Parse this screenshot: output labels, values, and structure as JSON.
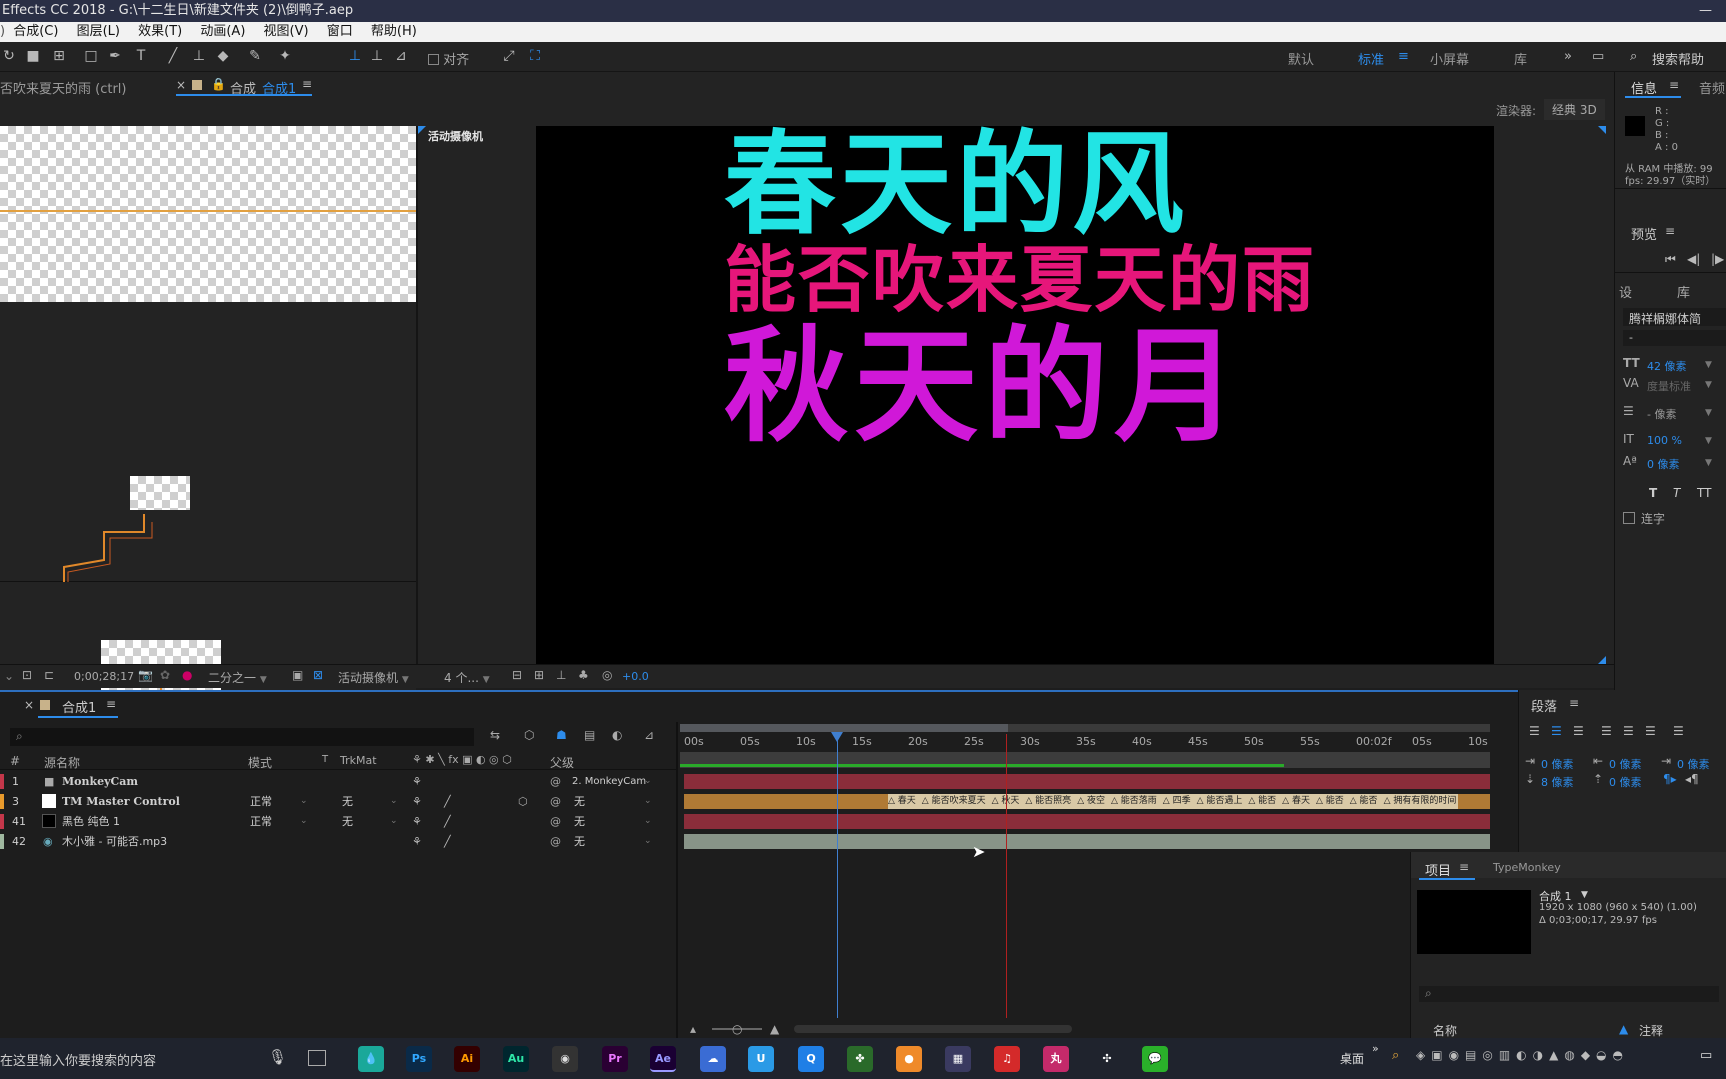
{
  "titlebar": {
    "title": "Effects CC 2018 - G:\\十二生日\\新建文件夹 (2)\\倒鸭子.aep",
    "win_controls": "—"
  },
  "menubar": {
    "items": [
      "合成(C)",
      "图层(L)",
      "效果(T)",
      "动画(A)",
      "视图(V)",
      "窗口",
      "帮助(H)"
    ]
  },
  "toolbar": {
    "align_label": "对齐",
    "workspaces": [
      "默认",
      "标准",
      "小屏幕",
      "库"
    ],
    "more": "»",
    "search_placeholder": "搜索帮助"
  },
  "comp_panel": {
    "left_tab": "否吹来夏天的雨 (ctrl)",
    "tab_label": "合成",
    "tab_name": "合成1",
    "renderer_label": "渲染器:",
    "renderer_value": "经典 3D",
    "camera_label": "活动摄像机",
    "lyrics": [
      "春天的风",
      "能否吹来夏天的雨",
      "秋天的月"
    ]
  },
  "viewer_bar": {
    "timecode": "0;00;28;17",
    "resolution": "二分之一",
    "camera": "活动摄像机",
    "views": "4 个...",
    "exposure": "+0.0"
  },
  "timeline": {
    "tab_label": "合成1",
    "search_placeholder": "",
    "columns": {
      "num": "#",
      "source": "源名称",
      "mode": "模式",
      "t": "T",
      "trkmat": "TrkMat",
      "parent": "父级"
    },
    "ruler": [
      "00s",
      "05s",
      "10s",
      "15s",
      "20s",
      "25s",
      "30s",
      "35s",
      "40s",
      "45s",
      "50s",
      "55s",
      "00:02f",
      "05s",
      "10s"
    ],
    "layers": [
      {
        "num": "1",
        "name": "MonkeyCam",
        "mode": "",
        "trkmat": "",
        "parent": "2. MonkeyCam",
        "color": "#c4374a"
      },
      {
        "num": "3",
        "name": "TM Master Control",
        "mode": "正常",
        "trkmat": "无",
        "parent": "无",
        "color": "#e89a2c"
      },
      {
        "num": "41",
        "name": "黑色 纯色 1",
        "mode": "正常",
        "trkmat": "无",
        "parent": "无",
        "color": "#c4374a"
      },
      {
        "num": "42",
        "name": "木小雅 - 可能否.mp3",
        "mode": "",
        "trkmat": "",
        "parent": "无",
        "color": "#9fb89f"
      }
    ],
    "markers": [
      "春天",
      "能否吹来夏天",
      "秋天",
      "能否照亮",
      "夜空",
      "能否落雨",
      "四季",
      "能否遇上",
      "能否",
      "春天",
      "能否",
      "能否",
      "拥有有限的时间"
    ]
  },
  "right_panel": {
    "info_tab": "信息",
    "audio_tab": "音频",
    "rgba": [
      "R :",
      "G :",
      "B :",
      "A : 0"
    ],
    "ram_text": "从 RAM 中播放: 99",
    "fps_text": "fps: 29.97（实时）",
    "preview_tab": "预览",
    "char_tab": "设",
    "lib_tab": "库",
    "font_name": "腾祥榍娜体简",
    "font_style": "-",
    "font_size": "42 像素",
    "kerning": "度量标准",
    "leading": "- 像素",
    "vscale": "100 %",
    "baseline": "0 像素",
    "ligature": "连字"
  },
  "para_panel": {
    "title": "段落",
    "indent_values": [
      "0 像素",
      "0 像素",
      "0 像素",
      "8 像素",
      "0 像素"
    ]
  },
  "project_panel": {
    "tab": "项目",
    "tab2": "TypeMonkey",
    "comp_name": "合成 1",
    "comp_res": "1920 x 1080 (960 x 540) (1.00)",
    "comp_dur": "Δ 0;03;00;17, 29.97 fps",
    "col_name": "名称",
    "col_note": "注释"
  },
  "taskbar": {
    "search_text": "在这里输入你要搜索的内容",
    "desktop_label": "桌面",
    "apps": [
      "Ps",
      "Ai",
      "Au",
      "Pr",
      "Ae"
    ]
  }
}
